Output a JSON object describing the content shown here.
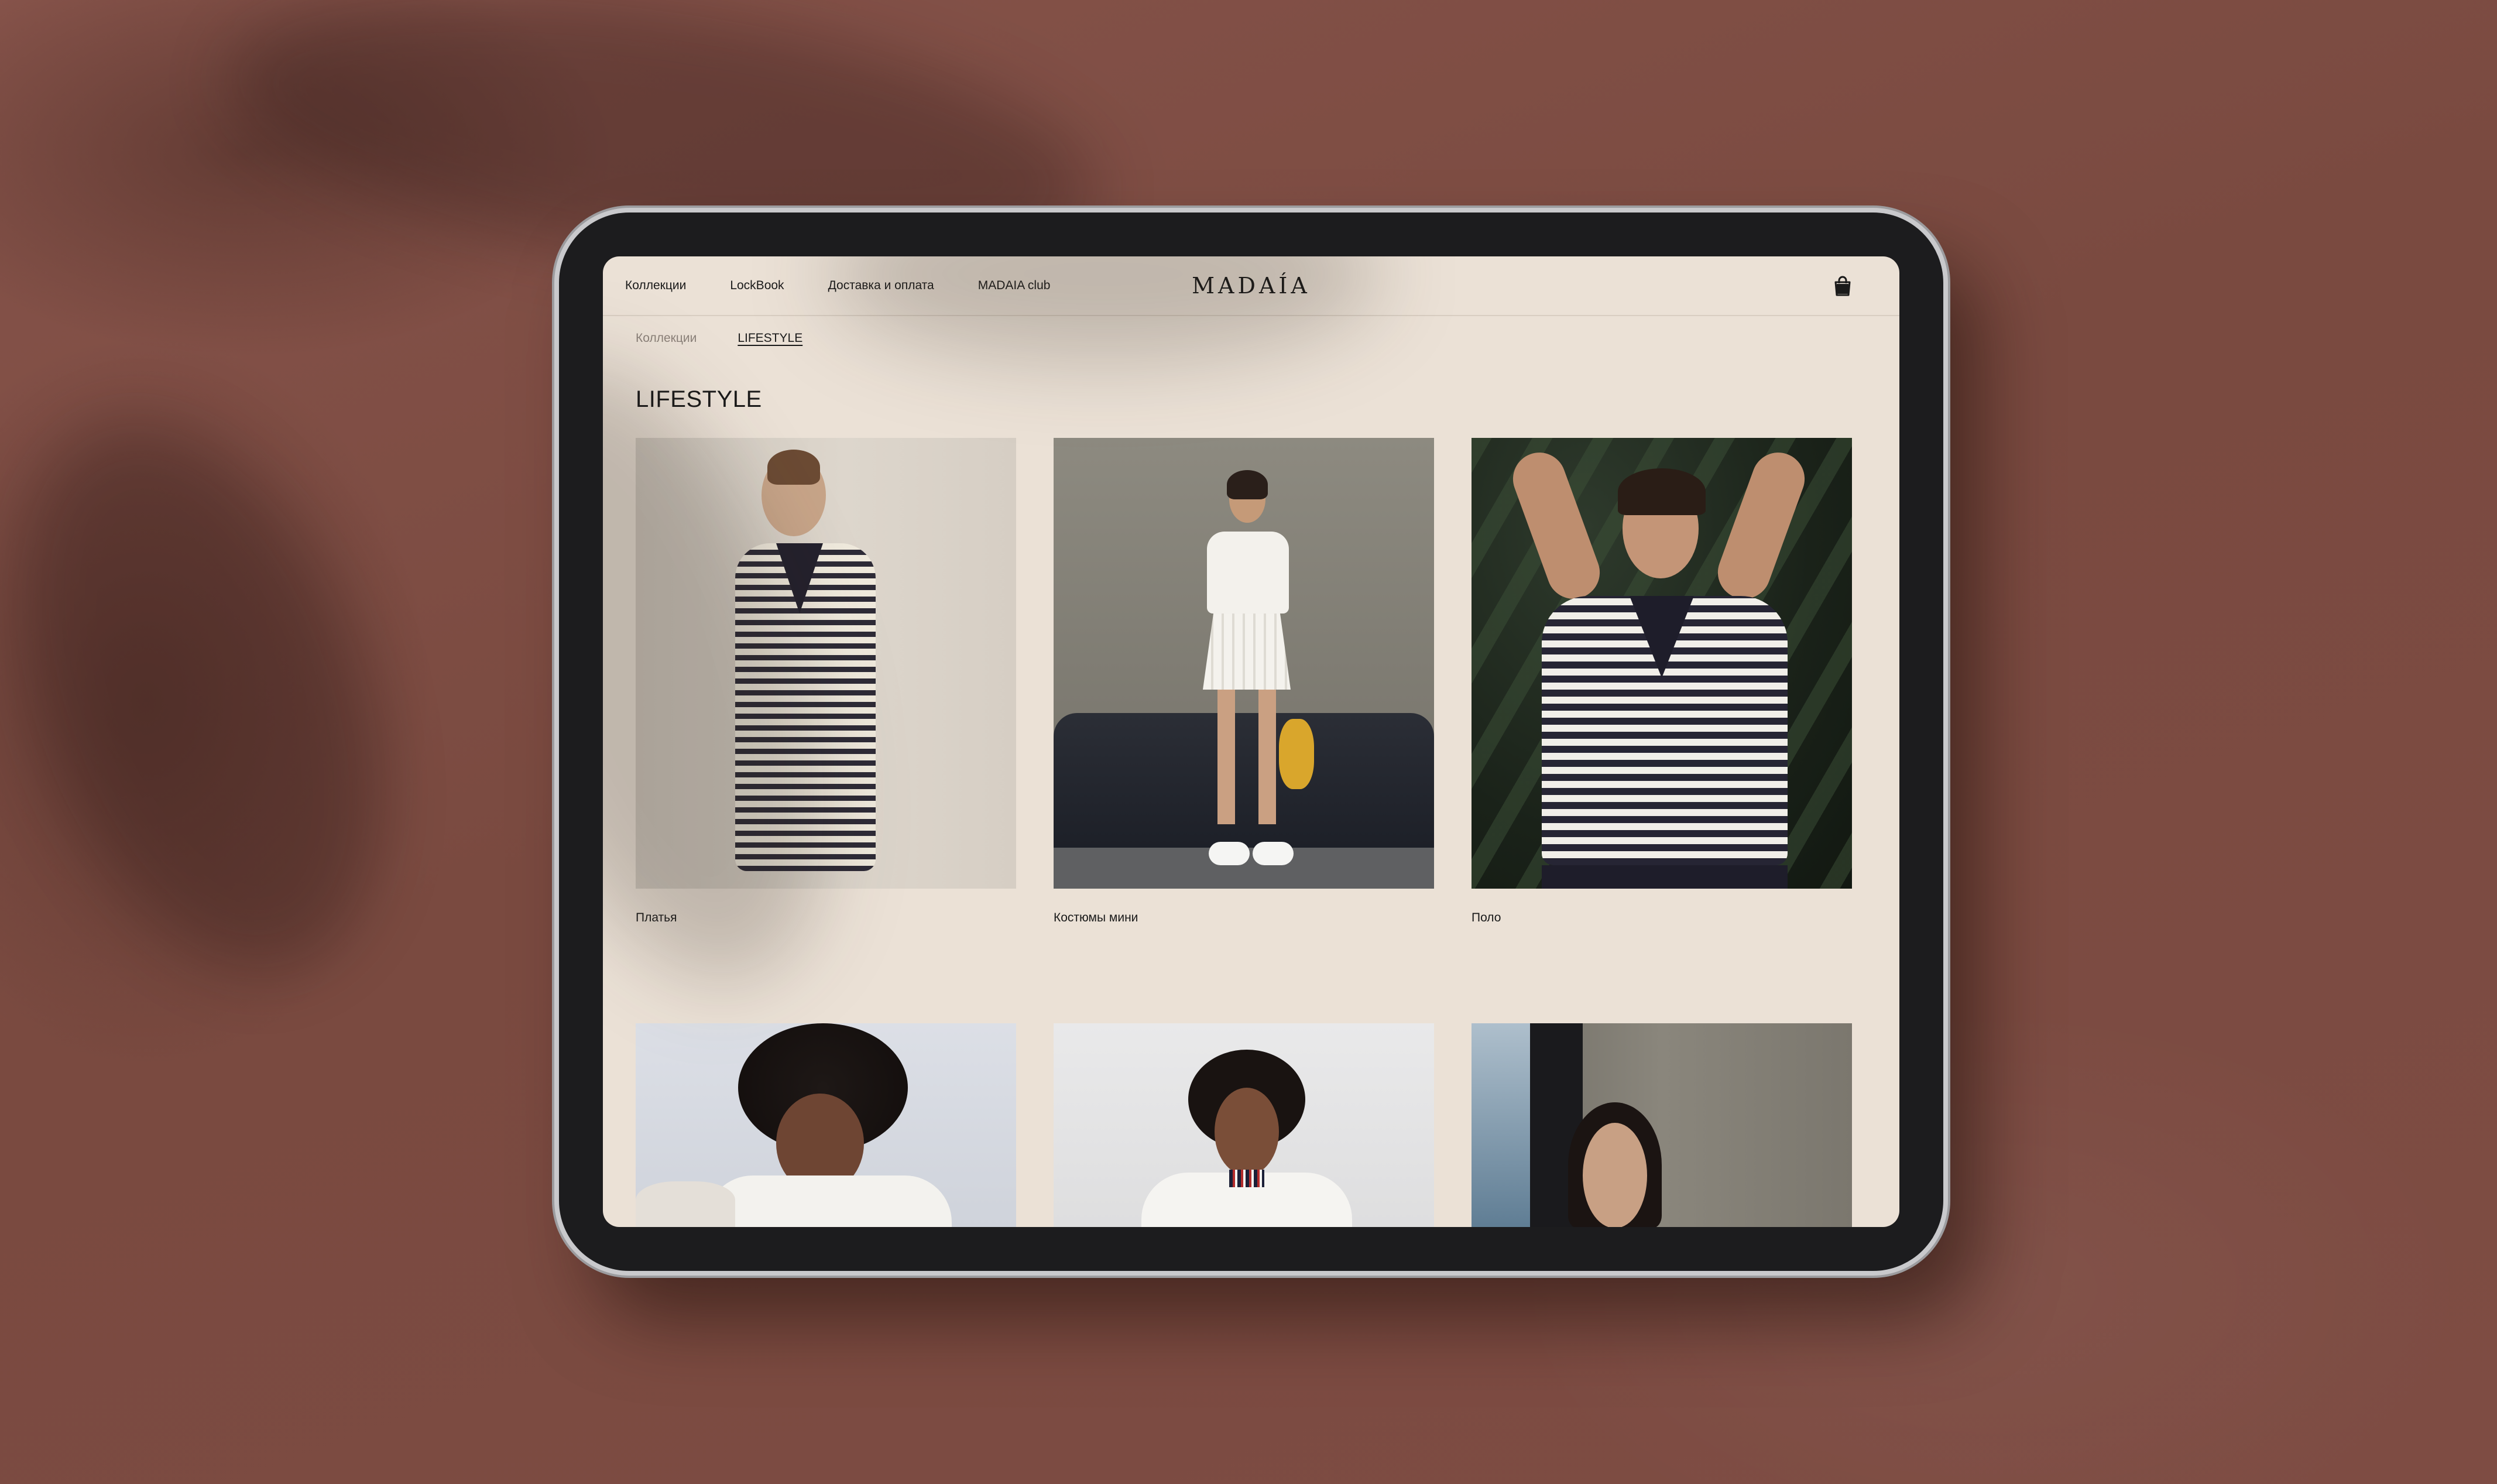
{
  "site": {
    "logo": "MADAÍA"
  },
  "nav": {
    "items": [
      {
        "label": "Коллекции"
      },
      {
        "label": "LockBook"
      },
      {
        "label": "Доставка и оплата"
      },
      {
        "label": "MADAIA club"
      }
    ],
    "cart_icon": "shopping-bag-icon"
  },
  "breadcrumb": {
    "items": [
      "Коллекции",
      "LIFESTYLE"
    ]
  },
  "page": {
    "title": "LIFESTYLE"
  },
  "collections": [
    {
      "label": "Платья"
    },
    {
      "label": "Костюмы мини"
    },
    {
      "label": "Поло"
    },
    {
      "label": ""
    },
    {
      "label": ""
    },
    {
      "label": ""
    }
  ],
  "colors": {
    "page_background": "#ebe1d6",
    "backdrop": "#7d4c42",
    "text": "#1a1a1a",
    "muted": "#8a8078"
  }
}
